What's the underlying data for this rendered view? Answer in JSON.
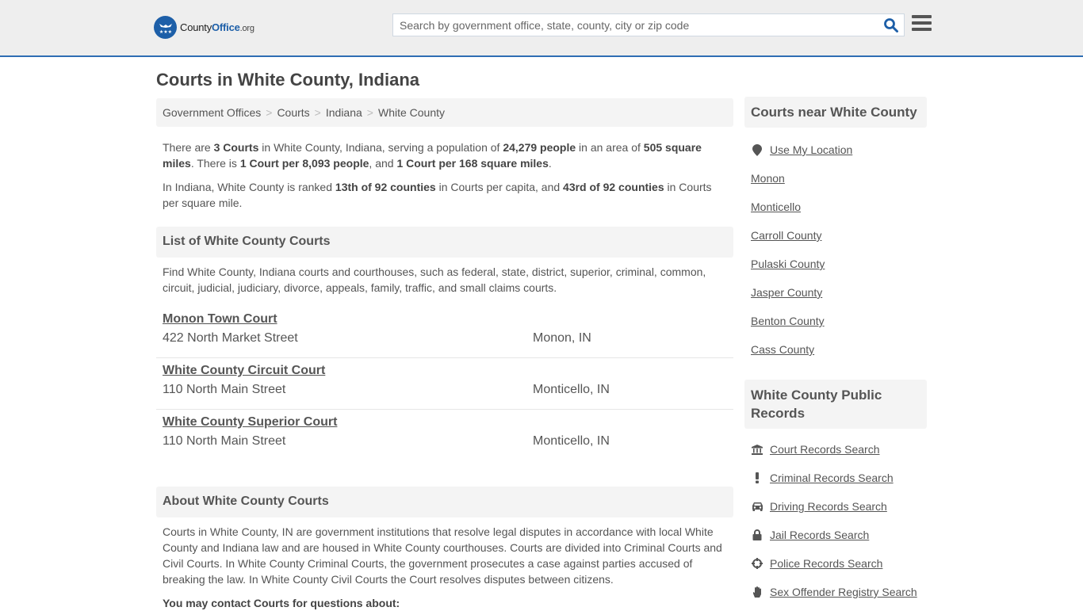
{
  "header": {
    "logo": {
      "prefix": "County",
      "bold": "Office",
      "suffix": ".org"
    },
    "search": {
      "placeholder": "Search by government office, state, county, city or zip code",
      "value": ""
    },
    "brand_color": "#1d5fa8"
  },
  "page_title": "Courts in White County, Indiana",
  "breadcrumb": [
    "Government Offices",
    "Courts",
    "Indiana",
    "White County"
  ],
  "summary": {
    "p1": {
      "t1": "There are ",
      "b1": "3 Courts",
      "t2": " in White County, Indiana, serving a population of ",
      "b2": "24,279 people",
      "t3": " in an area of ",
      "b3": "505 square miles",
      "t4": ". There is ",
      "b4": "1 Court per 8,093 people",
      "t5": ", and ",
      "b5": "1 Court per 168 square miles",
      "t6": "."
    },
    "p2": {
      "t1": "In Indiana, White County is ranked ",
      "b1": "13th of 92 counties",
      "t2": " in Courts per capita, and ",
      "b2": "43rd of 92 counties",
      "t3": " in Courts per square mile."
    }
  },
  "list_section": {
    "heading": "List of White County Courts",
    "intro": "Find White County, Indiana courts and courthouses, such as federal, state, district, superior, criminal, common, circuit, judicial, judiciary, divorce, appeals, family, traffic, and small claims courts.",
    "courts": [
      {
        "name": "Monon Town Court",
        "address": "422 North Market Street",
        "city": "Monon, IN"
      },
      {
        "name": "White County Circuit Court",
        "address": "110 North Main Street",
        "city": "Monticello, IN"
      },
      {
        "name": "White County Superior Court",
        "address": "110 North Main Street",
        "city": "Monticello, IN"
      }
    ]
  },
  "about_section": {
    "heading": "About White County Courts",
    "text": "Courts in White County, IN are government institutions that resolve legal disputes in accordance with local White County and Indiana law and are housed in White County courthouses. Courts are divided into Criminal Courts and Civil Courts. In White County Criminal Courts, the government prosecutes a case against parties accused of breaking the law. In White County Civil Courts the Court resolves disputes between citizens.",
    "contact_heading": "You may contact Courts for questions about:"
  },
  "sidebar": {
    "nearby": {
      "heading": "Courts near White County",
      "use_location": {
        "label": "Use My Location",
        "icon": "map-marker-icon"
      },
      "links": [
        "Monon",
        "Monticello",
        "Carroll County",
        "Pulaski County",
        "Jasper County",
        "Benton County",
        "Cass County"
      ]
    },
    "records": {
      "heading": "White County Public Records",
      "links": [
        {
          "label": "Court Records Search",
          "icon": "bank-icon"
        },
        {
          "label": "Criminal Records Search",
          "icon": "exclamation-icon"
        },
        {
          "label": "Driving Records Search",
          "icon": "car-icon"
        },
        {
          "label": "Jail Records Search",
          "icon": "lock-icon"
        },
        {
          "label": "Police Records Search",
          "icon": "crosshairs-icon"
        },
        {
          "label": "Sex Offender Registry Search",
          "icon": "hand-icon"
        }
      ]
    }
  }
}
